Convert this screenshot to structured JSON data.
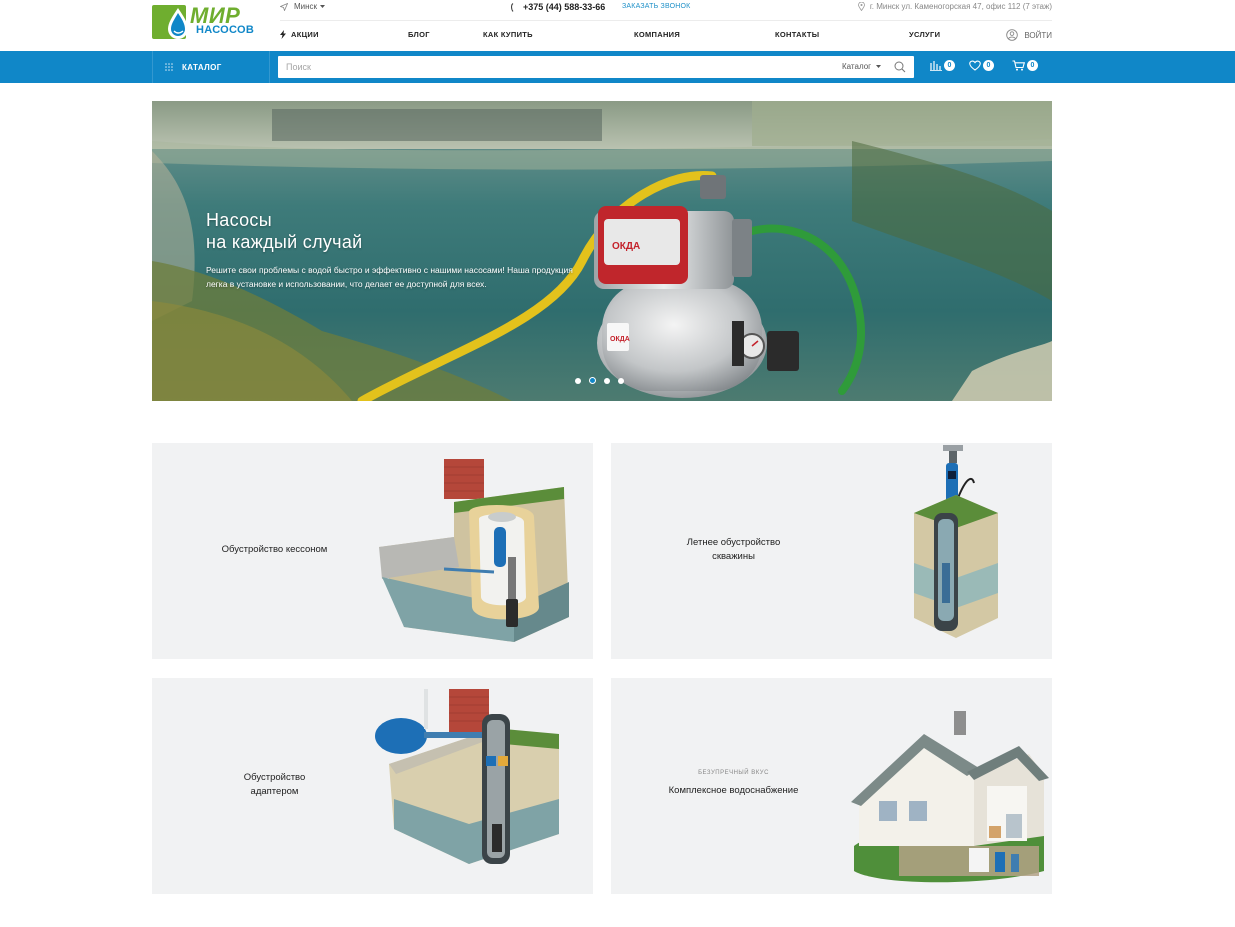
{
  "brand": {
    "logo_line1": "МИР",
    "logo_line2": "НАСОСОВ",
    "logo_green": "#6fae2f",
    "logo_blue": "#1087c8"
  },
  "topbar": {
    "city": "Минск",
    "phone": "+375 (44) 588-33-66",
    "callback": "ЗАКАЗАТЬ ЗВОНОК",
    "address": "г. Минск ул. Каменогорская 47, офис 112 (7 этаж)"
  },
  "nav": {
    "items": [
      {
        "label": "АКЦИИ"
      },
      {
        "label": "БЛОГ"
      },
      {
        "label": "КАК КУПИТЬ"
      },
      {
        "label": "КОМПАНИЯ"
      },
      {
        "label": "КОНТАКТЫ"
      },
      {
        "label": "УСЛУГИ"
      }
    ],
    "login": "ВОЙТИ"
  },
  "bluebar": {
    "color": "#1087c8",
    "catalog": "КАТАЛОГ",
    "search_placeholder": "Поиск",
    "search_scope": "Каталог",
    "compare_count": "0",
    "favorites_count": "0",
    "cart_count": "0",
    "icons": [
      "compare-icon",
      "heart-icon",
      "cart-icon"
    ]
  },
  "hero": {
    "title_line1": "Насосы",
    "title_line2": "на каждый случай",
    "description": "Решите свои проблемы с водой быстро и эффективно с нашими насосами! Наша продукция легка в установке и использовании, что делает ее доступной для всех.",
    "pump_brand": "ОКДА",
    "slides": 4,
    "active_slide": 2
  },
  "tiles": [
    {
      "line1": "Обустройство кессоном",
      "line2": ""
    },
    {
      "line1": "Летнее обустройство",
      "line2": "скважины"
    },
    {
      "line1": "Обустройство",
      "line2": "адаптером"
    },
    {
      "supertitle": "БЕЗУПРЕЧНЫЙ ВКУС",
      "line1": "Комплексное водоснабжение",
      "line2": ""
    }
  ]
}
